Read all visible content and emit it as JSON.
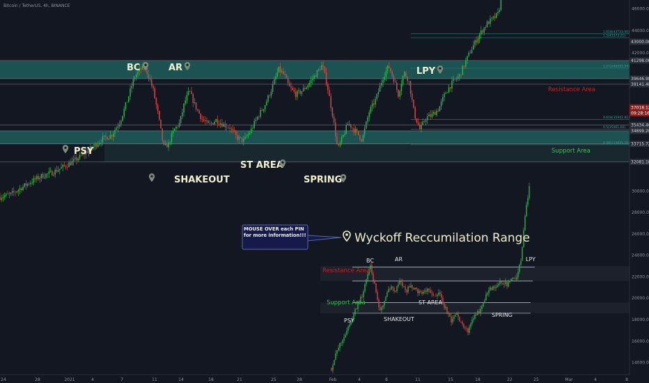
{
  "header": {
    "symbol_line": "Bitcoin / TetherUS, 4h, BINANCE"
  },
  "colors": {
    "background": "#131722",
    "up": "#26a69a",
    "down": "#ef5350",
    "bull_candle": "#2bb24c",
    "bear_candle": "#d64545",
    "resistance_zone": "#1e5e5b",
    "support_zone": "#1e5e5b",
    "resistance_label": "#b22a2a",
    "support_label": "#3dbb5c",
    "pin_text": "#f3f0cf",
    "pin_icon": "#7d8a7a",
    "callout_bg": "#151a4a",
    "callout_border": "#5a6aa8"
  },
  "main_pins": [
    {
      "label": "BC"
    },
    {
      "label": "AR"
    },
    {
      "label": "PSY"
    },
    {
      "label": "SHAKEOUT"
    },
    {
      "label": "ST AREA"
    },
    {
      "label": "SPRING"
    },
    {
      "label": "LPY"
    }
  ],
  "zones": {
    "resistance_label": "Resistance Area",
    "support_label": "Support Area"
  },
  "inset": {
    "title": "Wyckoff Reccumilation Range",
    "callout": "MOUSE OVER each PIN for more information!!!",
    "labels": [
      {
        "label": "BC"
      },
      {
        "label": "AR"
      },
      {
        "label": "LPY"
      },
      {
        "label": "PSY"
      },
      {
        "label": "SHAKEOUT"
      },
      {
        "label": "ST AREA"
      },
      {
        "label": "SPRING"
      }
    ],
    "resistance_label": "Resistance Area",
    "support_label": "Support Area"
  },
  "fib_labels": [
    "1.618(43733.00)",
    "1.5(43373.21)",
    "1.272(40593.54)",
    "0.618(35942.81)",
    "0.5(35061.60)",
    "0.382(33635.35)"
  ],
  "right_axis": {
    "ticks": [
      "46000.00",
      "44000.00",
      "42000.00",
      "30000.00",
      "28000.00",
      "26000.00",
      "24000.00",
      "22000.00",
      "20000.00",
      "18000.00",
      "16000.00",
      "14000.00"
    ],
    "tags": [
      {
        "text": "43000.00",
        "kind": "dark"
      },
      {
        "text": "41298.00",
        "kind": "dark"
      },
      {
        "text": "39646.98",
        "kind": "dark"
      },
      {
        "text": "39141.48",
        "kind": "dark"
      },
      {
        "text": "37018.12",
        "kind": "red"
      },
      {
        "text": "09:28:16",
        "kind": "red"
      },
      {
        "text": "35434.40",
        "kind": "dark"
      },
      {
        "text": "34899.20",
        "kind": "dark"
      },
      {
        "text": "33715.72",
        "kind": "dark"
      },
      {
        "text": "32081.10",
        "kind": "dark"
      }
    ]
  },
  "bottom_axis": {
    "ticks": [
      "24",
      "28",
      "2021",
      "4",
      "7",
      "11",
      "14",
      "18",
      "21",
      "25",
      "28",
      "Feb",
      "4",
      "8",
      "11",
      "15",
      "18",
      "22",
      "25",
      "Mar",
      "4",
      "8"
    ]
  },
  "chart_data": [
    {
      "type": "candlestick",
      "name": "main",
      "y_unit": "USDT",
      "ylim": [
        27800,
        46800
      ],
      "resistance_zone": [
        39650,
        41300
      ],
      "support_zone": [
        33700,
        34900
      ],
      "support_extension": [
        32100,
        33700
      ],
      "horizontal_levels": [
        41298,
        39647,
        39141,
        35434,
        34899,
        33716,
        32081
      ],
      "fib_levels": [
        {
          "label": "1.618(43733.00)",
          "value": 43733.0
        },
        {
          "label": "1.5(43373.21)",
          "value": 43373.21
        },
        {
          "label": "1.272(40593.54)",
          "value": 40593.54
        },
        {
          "label": "0.618(35942.81)",
          "value": 35942.81
        },
        {
          "label": "0.5(35061.60)",
          "value": 35061.6
        },
        {
          "label": "0.382(33635.35)",
          "value": 33635.35
        }
      ],
      "close_path": [
        [
          0,
          28900
        ],
        [
          15,
          29100
        ],
        [
          30,
          29700
        ],
        [
          45,
          30300
        ],
        [
          60,
          30800
        ],
        [
          75,
          31100
        ],
        [
          90,
          31600
        ],
        [
          105,
          32100
        ],
        [
          120,
          32800
        ],
        [
          135,
          33500
        ],
        [
          148,
          34200
        ],
        [
          160,
          34500
        ],
        [
          172,
          35700
        ],
        [
          183,
          37700
        ],
        [
          193,
          39800
        ],
        [
          200,
          40400
        ],
        [
          207,
          40700
        ],
        [
          213,
          40000
        ],
        [
          220,
          38600
        ],
        [
          227,
          36400
        ],
        [
          235,
          33400
        ],
        [
          242,
          33700
        ],
        [
          250,
          35000
        ],
        [
          258,
          35600
        ],
        [
          265,
          37500
        ],
        [
          272,
          38500
        ],
        [
          280,
          37200
        ],
        [
          290,
          36000
        ],
        [
          300,
          35400
        ],
        [
          310,
          35900
        ],
        [
          320,
          35500
        ],
        [
          330,
          35200
        ],
        [
          340,
          34300
        ],
        [
          350,
          34000
        ],
        [
          360,
          34900
        ],
        [
          370,
          36200
        ],
        [
          380,
          37200
        ],
        [
          390,
          38700
        ],
        [
          400,
          40500
        ],
        [
          408,
          40000
        ],
        [
          415,
          38900
        ],
        [
          425,
          38200
        ],
        [
          435,
          38600
        ],
        [
          445,
          39300
        ],
        [
          455,
          40200
        ],
        [
          463,
          40900
        ],
        [
          470,
          39000
        ],
        [
          478,
          36200
        ],
        [
          485,
          33200
        ],
        [
          492,
          34300
        ],
        [
          500,
          35600
        ],
        [
          510,
          34900
        ],
        [
          520,
          34100
        ],
        [
          530,
          36600
        ],
        [
          540,
          37800
        ],
        [
          550,
          39800
        ],
        [
          558,
          40800
        ],
        [
          565,
          39700
        ],
        [
          572,
          38200
        ],
        [
          580,
          40200
        ],
        [
          587,
          39500
        ],
        [
          595,
          36400
        ],
        [
          603,
          35000
        ],
        [
          612,
          36100
        ],
        [
          620,
          36300
        ],
        [
          630,
          36900
        ],
        [
          640,
          38400
        ],
        [
          650,
          39300
        ],
        [
          660,
          39900
        ],
        [
          670,
          41400
        ],
        [
          680,
          42700
        ],
        [
          690,
          43800
        ],
        [
          700,
          44700
        ],
        [
          710,
          45200
        ],
        [
          716,
          45600
        ],
        [
          720,
          47200
        ],
        [
          726,
          48500
        ],
        [
          732,
          49300
        ]
      ],
      "candle_bounds": [
        0,
        732
      ]
    },
    {
      "type": "candlestick",
      "name": "inset",
      "y_unit": "USDT",
      "ylim": [
        13000,
        30800
      ],
      "resistance_line": 22900,
      "upper_band": [
        21600,
        23000
      ],
      "support_line": 19600,
      "lower_line": 18600,
      "support_band": [
        18600,
        19600
      ],
      "close_path": [
        [
          476,
          13500
        ],
        [
          486,
          15400
        ],
        [
          496,
          16700
        ],
        [
          506,
          18200
        ],
        [
          514,
          19500
        ],
        [
          520,
          20200
        ],
        [
          526,
          21800
        ],
        [
          532,
          22900
        ],
        [
          538,
          21200
        ],
        [
          545,
          18600
        ],
        [
          552,
          19800
        ],
        [
          560,
          21000
        ],
        [
          568,
          20800
        ],
        [
          575,
          21700
        ],
        [
          582,
          20600
        ],
        [
          590,
          21200
        ],
        [
          598,
          20700
        ],
        [
          606,
          20500
        ],
        [
          614,
          20700
        ],
        [
          622,
          20200
        ],
        [
          630,
          20500
        ],
        [
          640,
          19000
        ],
        [
          648,
          17800
        ],
        [
          656,
          18600
        ],
        [
          664,
          17400
        ],
        [
          672,
          16900
        ],
        [
          680,
          18300
        ],
        [
          688,
          18800
        ],
        [
          696,
          20000
        ],
        [
          704,
          20800
        ],
        [
          712,
          21000
        ],
        [
          720,
          21500
        ],
        [
          728,
          21300
        ],
        [
          736,
          22000
        ],
        [
          742,
          21900
        ],
        [
          748,
          23600
        ],
        [
          752,
          26200
        ],
        [
          756,
          28700
        ],
        [
          760,
          30300
        ]
      ],
      "candle_bounds": [
        476,
        760
      ]
    }
  ]
}
